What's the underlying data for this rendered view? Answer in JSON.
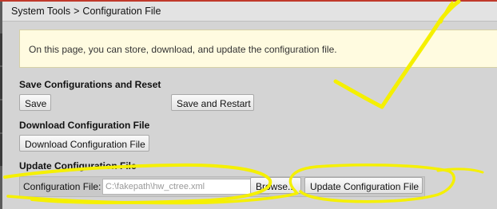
{
  "breadcrumb": {
    "parent": "System Tools",
    "separator": ">",
    "current": "Configuration File"
  },
  "note": {
    "text": "On this page, you can store, download, and update the configuration file."
  },
  "save_section": {
    "title": "Save Configurations and Reset",
    "save_label": "Save",
    "save_restart_label": "Save and Restart"
  },
  "download_section": {
    "title": "Download Configuration File",
    "download_label": "Download Configuration File"
  },
  "update_section": {
    "title": "Update Configuration File",
    "field_label": "Configuration File:",
    "file_value": "C:\\fakepath\\hw_ctree.xml",
    "browse_label": "Browse...",
    "update_label": "Update Configuration File"
  },
  "colors": {
    "top_rule": "#c0392b",
    "note_background": "#fffbe0",
    "annotation_marker": "#f5f000"
  }
}
